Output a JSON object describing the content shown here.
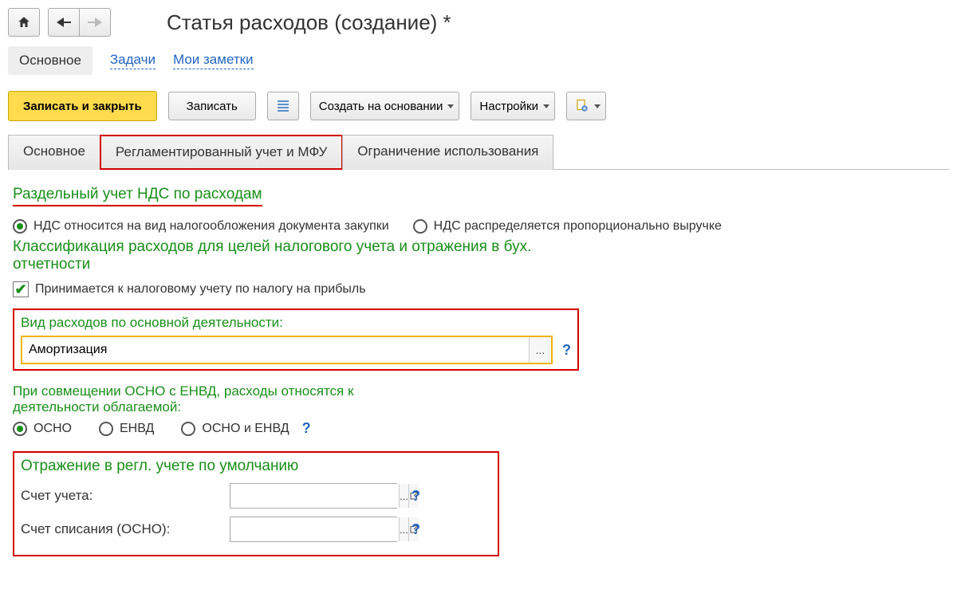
{
  "header": {
    "title": "Статья расходов (создание) *"
  },
  "nav": {
    "main": "Основное",
    "tasks": "Задачи",
    "notes": "Мои заметки"
  },
  "toolbar": {
    "save_close": "Записать и закрыть",
    "save": "Записать",
    "create_based": "Создать на основании",
    "settings": "Настройки"
  },
  "tabs": {
    "main": "Основное",
    "reg": "Регламентированный учет и МФУ",
    "restrict": "Ограничение использования"
  },
  "vat": {
    "title": "Раздельный учет НДС по расходам",
    "opt1": "НДС относится на вид налогообложения документа закупки",
    "opt2": "НДС распределяется пропорционально выручке"
  },
  "classification": {
    "title": "Классификация расходов для целей налогового учета и отражения в бух. отчетности",
    "checkbox": "Принимается к налоговому учету по налогу на прибыль"
  },
  "expense_type": {
    "label": "Вид расходов по основной деятельности:",
    "value": "Амортизация"
  },
  "osno": {
    "label": "При совмещении ОСНО с ЕНВД, расходы относятся к деятельности облагаемой:",
    "o1": "ОСНО",
    "o2": "ЕНВД",
    "o3": "ОСНО и ЕНВД"
  },
  "accounts": {
    "title": "Отражение в регл. учете по умолчанию",
    "acc1_label": "Счет учета:",
    "acc2_label": "Счет списания (ОСНО):"
  }
}
